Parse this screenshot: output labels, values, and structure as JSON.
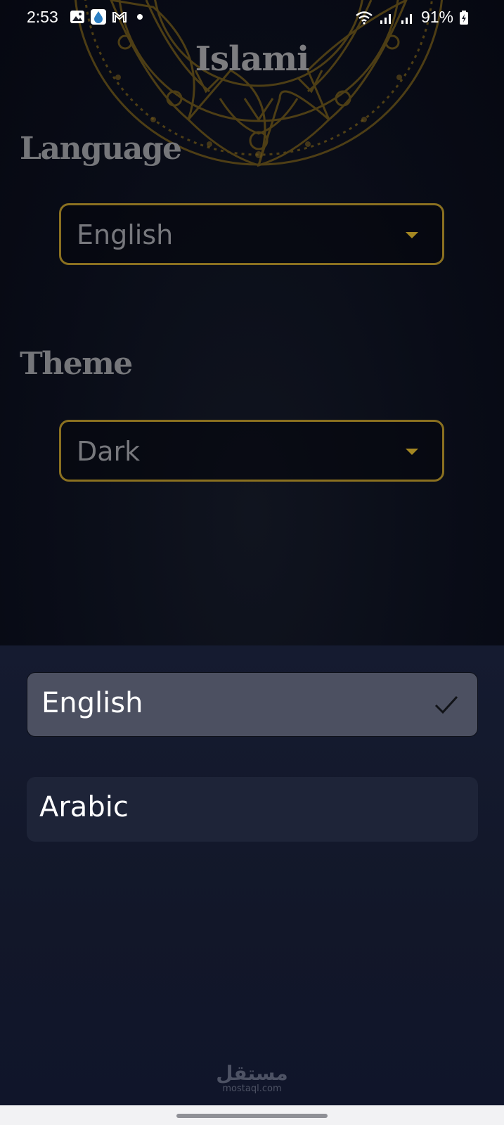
{
  "status_bar": {
    "time": "2:53",
    "battery": "91%",
    "icons": [
      "gallery-icon",
      "app-drop-icon",
      "gmail-icon",
      "notification-dot",
      "wifi-icon",
      "signal-icon",
      "signal-icon",
      "battery-charging-icon"
    ]
  },
  "app": {
    "title": "Islami"
  },
  "settings": {
    "language_heading": "Language",
    "language_value": "English",
    "theme_heading": "Theme",
    "theme_value": "Dark"
  },
  "sheet": {
    "options": [
      {
        "label": "English",
        "selected": true
      },
      {
        "label": "Arabic",
        "selected": false
      }
    ]
  },
  "watermark": {
    "arabic": "مستقل",
    "latin": "mostaql.com"
  },
  "colors": {
    "accent_gold": "#8a7020",
    "sheet_bg": "#141a2e",
    "selected_option_bg": "#4c5061"
  }
}
